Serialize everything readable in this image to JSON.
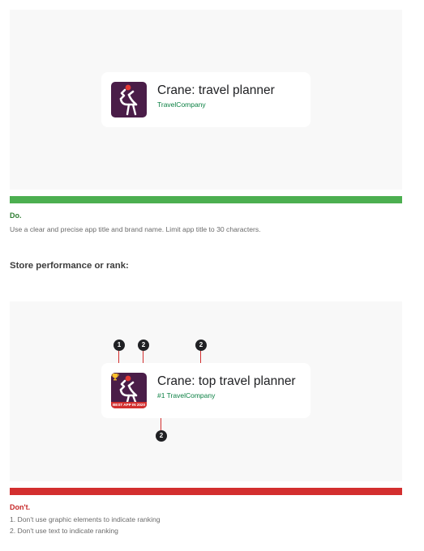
{
  "example_do": {
    "app_title": "Crane: travel planner",
    "brand_name": "TravelCompany"
  },
  "do_section": {
    "label": "Do.",
    "description": "Use a clear and precise app title and brand name. Limit app title to 30 characters."
  },
  "section_heading": "Store performance or rank:",
  "example_dont": {
    "app_title": "Crane: top travel planner",
    "brand_name": "#1 TravelCompany",
    "badge_text": "BEST APP IN 2020",
    "markers": [
      "1",
      "2",
      "2",
      "2"
    ]
  },
  "dont_section": {
    "label": "Don't.",
    "items": [
      "1. Don't use graphic elements to indicate ranking",
      "2. Don't use text to indicate ranking"
    ]
  },
  "colors": {
    "do_green": "#4caf50",
    "dont_red": "#d32f2f",
    "brand_green": "#0b8043",
    "icon_bg": "#4a1d48"
  },
  "icons": {
    "app": "crane-bird-icon",
    "award": "trophy-icon"
  }
}
